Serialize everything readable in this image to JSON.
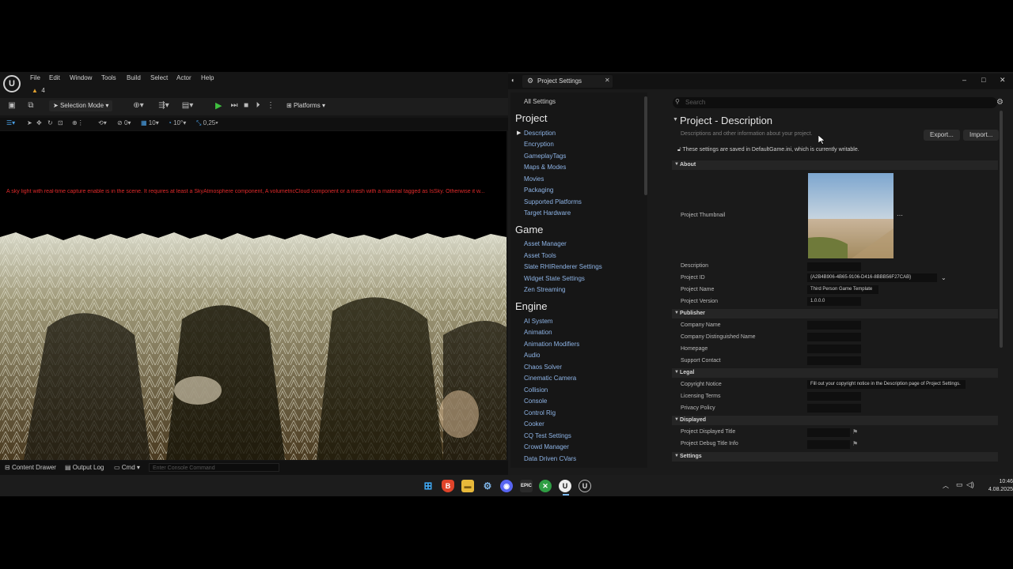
{
  "editor": {
    "menu": [
      "File",
      "Edit",
      "Window",
      "Tools",
      "Build",
      "Select",
      "Actor",
      "Help"
    ],
    "project_badge": "4",
    "selection_mode": "Selection Mode",
    "platforms": "Platforms",
    "viewport_tools": {
      "rot_snap": "0",
      "grid": "10",
      "angle": "10°",
      "scale": "0,25"
    },
    "warning": "A sky light with real-time capture enable is in the scene. It requires at least a SkyAtmosphere component, A volumetricCloud component or a mesh with a material tagged as IsSky. Otherwise it w...",
    "status": {
      "content_drawer": "Content Drawer",
      "output_log": "Output Log",
      "cmd": "Cmd",
      "console_placeholder": "Enter Console Command"
    }
  },
  "settings": {
    "window_title": "Project Settings",
    "nav": {
      "all": "All Settings",
      "project_heading": "Project",
      "project_items": [
        "Description",
        "Encryption",
        "GameplayTags",
        "Maps & Modes",
        "Movies",
        "Packaging",
        "Supported Platforms",
        "Target Hardware"
      ],
      "game_heading": "Game",
      "game_items": [
        "Asset Manager",
        "Asset Tools",
        "Slate RHIRenderer Settings",
        "Widget State Settings",
        "Zen Streaming"
      ],
      "engine_heading": "Engine",
      "engine_items": [
        "AI System",
        "Animation",
        "Animation Modifiers",
        "Audio",
        "Chaos Solver",
        "Cinematic Camera",
        "Collision",
        "Console",
        "Control Rig",
        "Cooker",
        "CQ Test Settings",
        "Crowd Manager",
        "Data Driven CVars"
      ]
    },
    "search_placeholder": "Search",
    "section_title": "Project - Description",
    "section_desc": "Descriptions and other information about your project.",
    "export_label": "Export...",
    "import_label": "Import...",
    "lock_note": "These settings are saved in DefaultGame.ini, which is currently writable.",
    "categories": {
      "about": "About",
      "publisher": "Publisher",
      "legal": "Legal",
      "displayed": "Displayed",
      "settings": "Settings"
    },
    "about": {
      "thumbnail_label": "Project Thumbnail",
      "description_label": "Description",
      "description_value": "",
      "project_id_label": "Project ID",
      "project_id_value": "{A2B4B906-4B65-9106-D416-8BBB56F27CAB}",
      "project_name_label": "Project Name",
      "project_name_value": "Third Person Game Template",
      "project_version_label": "Project Version",
      "project_version_value": "1.0.0.0"
    },
    "publisher": {
      "company_name_label": "Company Name",
      "company_distinguished_label": "Company Distinguished Name",
      "homepage_label": "Homepage",
      "support_contact_label": "Support Contact"
    },
    "legal": {
      "copyright_label": "Copyright Notice",
      "copyright_value": "Fill out your copyright notice in the Description page of Project Settings.",
      "licensing_label": "Licensing Terms",
      "privacy_label": "Privacy Policy"
    },
    "displayed": {
      "displayed_title_label": "Project Displayed Title",
      "debug_title_label": "Project Debug Title Info"
    }
  },
  "taskbar": {
    "time": "10:46",
    "date": "4.08.2025",
    "icons": [
      "windows-start-icon",
      "brave-icon",
      "file-explorer-icon",
      "settings-icon",
      "discord-icon",
      "epic-games-icon",
      "xbox-icon",
      "unreal-engine-icon",
      "unreal-editor-icon"
    ]
  },
  "colors": {
    "warning_red": "#e02a2a",
    "link_blue": "#8eb4e6",
    "play_green": "#3fbf3f"
  }
}
